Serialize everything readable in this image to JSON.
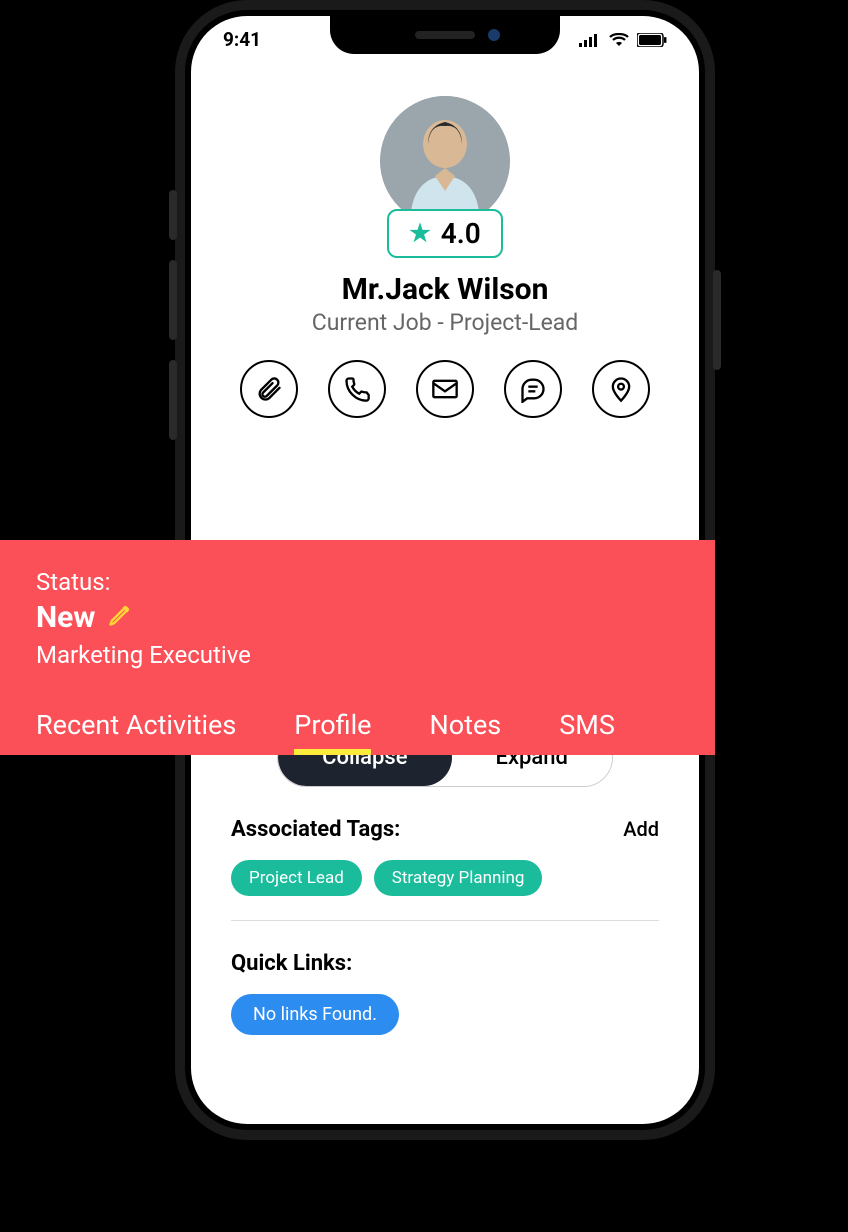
{
  "statusBar": {
    "time": "9:41"
  },
  "profile": {
    "rating": "4.0",
    "name": "Mr.Jack Wilson",
    "job": "Current Job - Project-Lead"
  },
  "statusPanel": {
    "label": "Status:",
    "value": "New",
    "role": "Marketing Executive"
  },
  "tabs": {
    "recent": "Recent Activities",
    "profile": "Profile",
    "notes": "Notes",
    "sms": "SMS"
  },
  "toggle": {
    "collapse": "Collapse",
    "expand": "Expand"
  },
  "tagsSection": {
    "title": "Associated Tags:",
    "add": "Add",
    "items": [
      "Project Lead",
      "Strategy Planning"
    ]
  },
  "linksSection": {
    "title": "Quick Links:",
    "empty": "No links Found."
  }
}
